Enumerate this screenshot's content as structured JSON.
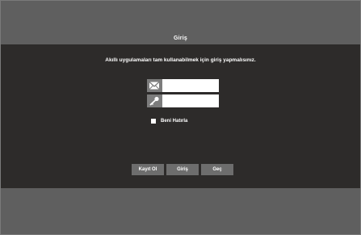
{
  "dialog": {
    "title": "Giriş",
    "message": "Akıllı uygulamaları tam kullanabilmek için giriş yapmalısınız."
  },
  "form": {
    "email_icon": "envelope-icon",
    "email_value": "",
    "password_icon": "key-icon",
    "password_value": "",
    "remember_label": "Beni Hatırla",
    "remember_checked": false
  },
  "buttons": {
    "register_label": "Kayıt Ol",
    "login_label": "Giriş",
    "skip_label": "Geç"
  },
  "colors": {
    "background": "#5b5b5b",
    "panel": "#2d2b2a",
    "button": "#6d6d6d",
    "icon_tab": "#7c7c7c"
  }
}
